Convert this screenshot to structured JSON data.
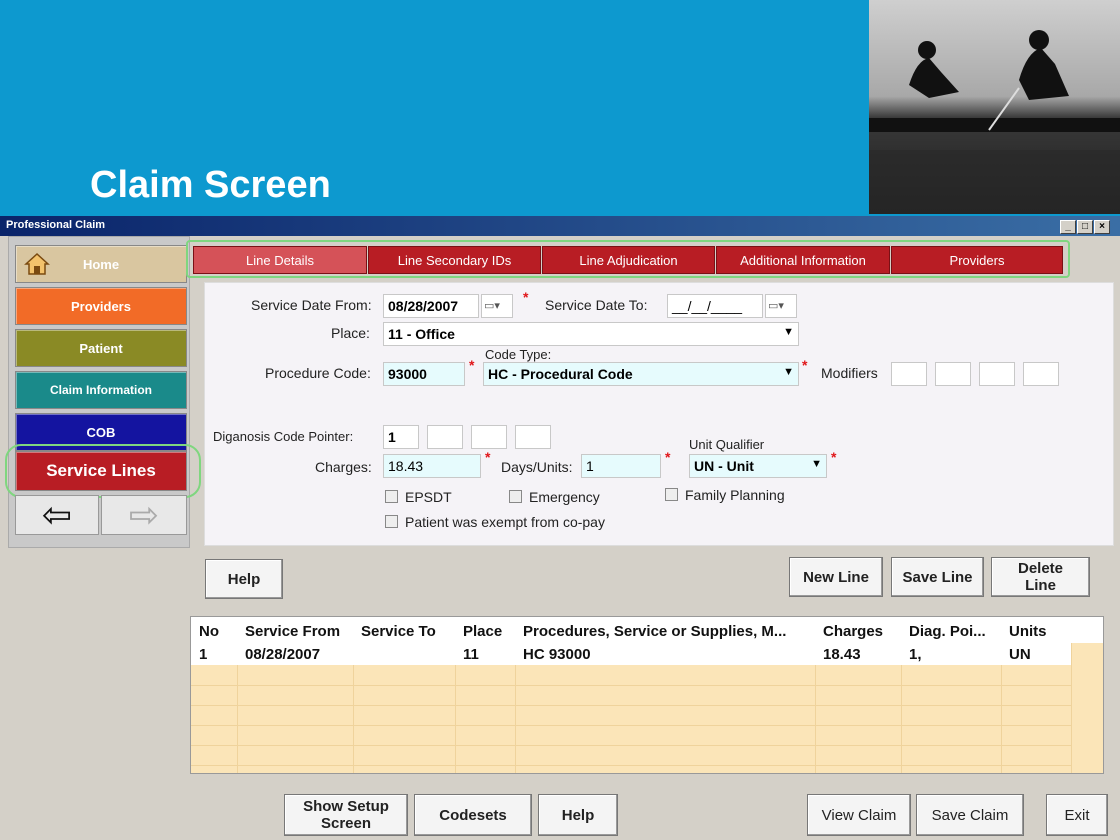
{
  "slide": {
    "title": "Claim Screen"
  },
  "window": {
    "title": "Professional Claim",
    "controls": [
      "_",
      "□",
      "×"
    ]
  },
  "nav": {
    "home": "Home",
    "providers": "Providers",
    "patient": "Patient",
    "claim_info": "Claim Information",
    "cob": "COB",
    "service_lines": "Service Lines",
    "back_arrow": "⇦",
    "forward_arrow": "⇨"
  },
  "tabs": [
    "Line Details",
    "Line Secondary IDs",
    "Line Adjudication",
    "Additional Information",
    "Providers"
  ],
  "form": {
    "service_date_from_label": "Service Date From:",
    "service_date_from": "08/28/2007",
    "service_date_to_label": "Service Date To:",
    "service_date_to": "__/__/____",
    "place_label": "Place:",
    "place": "11 - Office",
    "code_type_label": "Code Type:",
    "procedure_code_label": "Procedure Code:",
    "procedure_code": "93000",
    "code_type": "HC - Procedural Code",
    "modifiers_label": "Modifiers",
    "diag_pointer_label": "Diganosis Code Pointer:",
    "diag_pointer": [
      "1",
      "",
      "",
      ""
    ],
    "unit_qualifier_label": "Unit Qualifier",
    "charges_label": "Charges:",
    "charges": "18.43",
    "days_units_label": "Days/Units:",
    "days_units": "1",
    "unit_qualifier": "UN - Unit",
    "epsdt": "EPSDT",
    "emergency": "Emergency",
    "family_planning": "Family Planning",
    "copay_exempt": "Patient was exempt from co-pay",
    "required_marker": "*"
  },
  "buttons": {
    "help": "Help",
    "new_line": "New Line",
    "save_line": "Save Line",
    "delete_line": "Delete Line"
  },
  "grid": {
    "columns": [
      "No",
      "Service From",
      "Service To",
      "Place",
      "Procedures, Service or Supplies, M...",
      "Charges",
      "Diag. Poi...",
      "Units"
    ],
    "rows": [
      [
        "1",
        "08/28/2007",
        "",
        "11",
        "HC 93000",
        "18.43",
        "1,",
        "UN"
      ]
    ]
  },
  "bottom": {
    "show_setup": "Show Setup Screen",
    "codesets": "Codesets",
    "help": "Help",
    "view_claim": "View Claim",
    "save_claim": "Save Claim",
    "exit": "Exit"
  },
  "icons": {
    "home": "house-icon",
    "calendar": "calendar-icon",
    "dropdown": "chevron-down-icon"
  },
  "colors": {
    "background": "#0d99cf",
    "tab_red": "#b81d24",
    "highlight_green": "#7fd67f",
    "grid_fill": "#fbe5b8"
  }
}
